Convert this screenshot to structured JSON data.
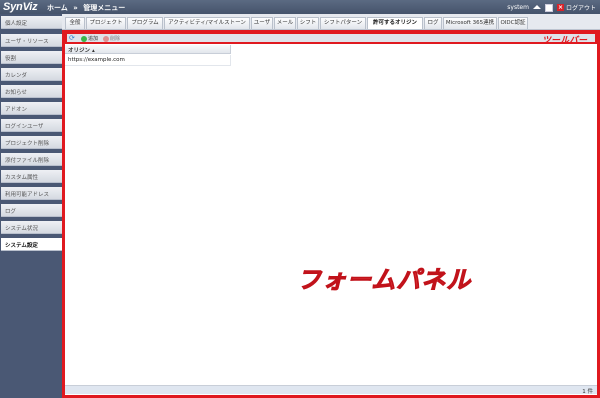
{
  "header": {
    "logo": "SynViz",
    "breadcrumb": [
      "ホーム",
      "管理メニュー"
    ],
    "user": "system",
    "logout": "ログアウト"
  },
  "sidebar": {
    "items": [
      {
        "label": "個人設定",
        "active": false
      },
      {
        "label": "ユーザ・リソース",
        "active": false
      },
      {
        "label": "役割",
        "active": false
      },
      {
        "label": "カレンダ",
        "active": false
      },
      {
        "label": "お知らせ",
        "active": false
      },
      {
        "label": "アドオン",
        "active": false
      },
      {
        "label": "ログインユーザ",
        "active": false
      },
      {
        "label": "プロジェクト削除",
        "active": false
      },
      {
        "label": "添付ファイル削除",
        "active": false
      },
      {
        "label": "カスタム属性",
        "active": false
      },
      {
        "label": "利用可能アドレス",
        "active": false
      },
      {
        "label": "ログ",
        "active": false
      },
      {
        "label": "システム状況",
        "active": false
      },
      {
        "label": "システム設定",
        "active": true
      }
    ]
  },
  "tabs": [
    {
      "label": "全般",
      "active": false
    },
    {
      "label": "プロジェクト",
      "active": false
    },
    {
      "label": "プログラム",
      "active": false
    },
    {
      "label": "アクティビティ/マイルストーン",
      "active": false
    },
    {
      "label": "ユーザ",
      "active": false
    },
    {
      "label": "メール",
      "active": false
    },
    {
      "label": "シフト",
      "active": false
    },
    {
      "label": "シフトパターン",
      "active": false
    },
    {
      "label": "許可するオリジン",
      "active": true
    },
    {
      "label": "ログ",
      "active": false
    },
    {
      "label": "Microsoft 365連携",
      "active": false
    },
    {
      "label": "OIDC認証",
      "active": false
    }
  ],
  "toolbar": {
    "add_label": "追加",
    "delete_label": "削除",
    "annotation": "ツールバー"
  },
  "grid": {
    "column_header": "オリジン",
    "sort_indicator": "▴",
    "rows": [
      "https://example.com"
    ]
  },
  "annotation_panel": "フォームパネル",
  "status": {
    "count": "1 件"
  }
}
